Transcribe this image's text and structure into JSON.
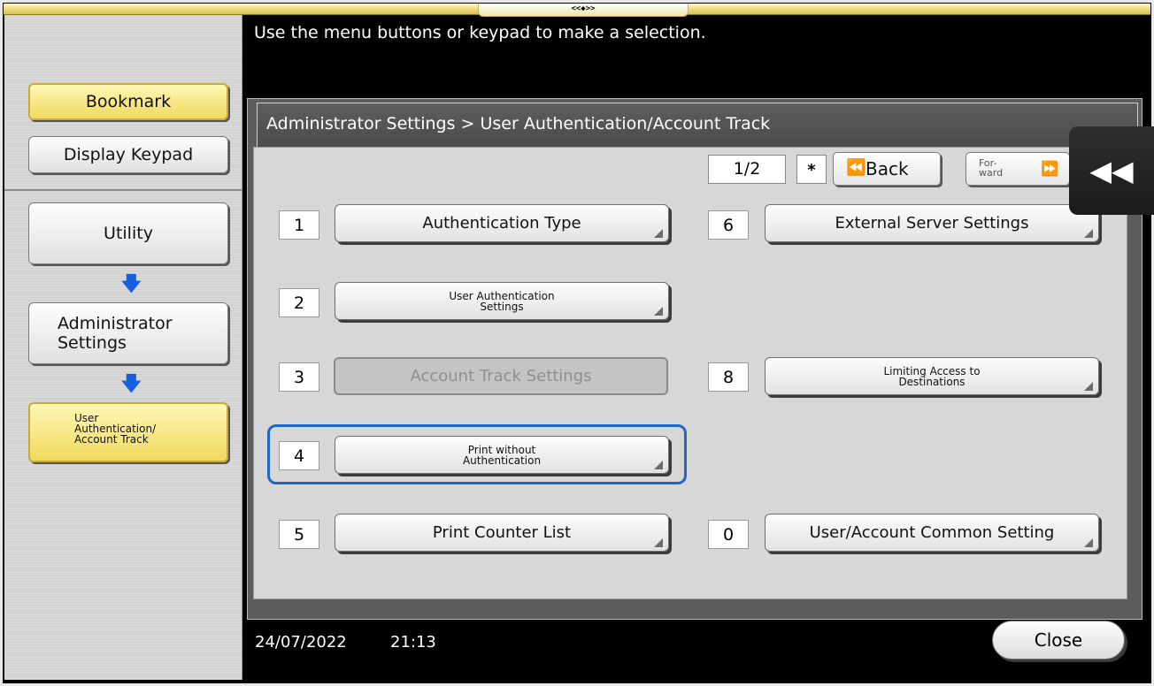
{
  "top_tab_glyph": "<<◆>>",
  "instruction": "Use the menu buttons or keypad to make a selection.",
  "sidebar": {
    "bookmark": "Bookmark",
    "display_keypad": "Display Keypad",
    "utility": "Utility",
    "administrator_settings": "Administrator Settings",
    "user_auth": "User Authentication/ Account Track"
  },
  "dialog": {
    "title": "Administrator Settings > User Authentication/Account Track",
    "page": "1/2",
    "star": "*",
    "back_label": "Back",
    "forward_label_line1": "For-",
    "forward_label_line2": "ward"
  },
  "menu": [
    {
      "num": "1",
      "label": "Authentication Type"
    },
    {
      "num": "2",
      "label": "User Authentication Settings"
    },
    {
      "num": "3",
      "label": "Account Track Settings"
    },
    {
      "num": "4",
      "label": "Print without Authentication"
    },
    {
      "num": "5",
      "label": "Print Counter List"
    },
    {
      "num": "6",
      "label": "External Server Settings"
    },
    {
      "num": "8",
      "label": "Limiting Access to Destinations"
    },
    {
      "num": "0",
      "label": "User/Account Common Setting"
    }
  ],
  "footer": {
    "date": "24/07/2022",
    "time": "21:13",
    "close": "Close"
  },
  "colors": {
    "highlight": "#1f66c9",
    "yellow": "#f1da5f",
    "arrow": "#1560e0"
  }
}
